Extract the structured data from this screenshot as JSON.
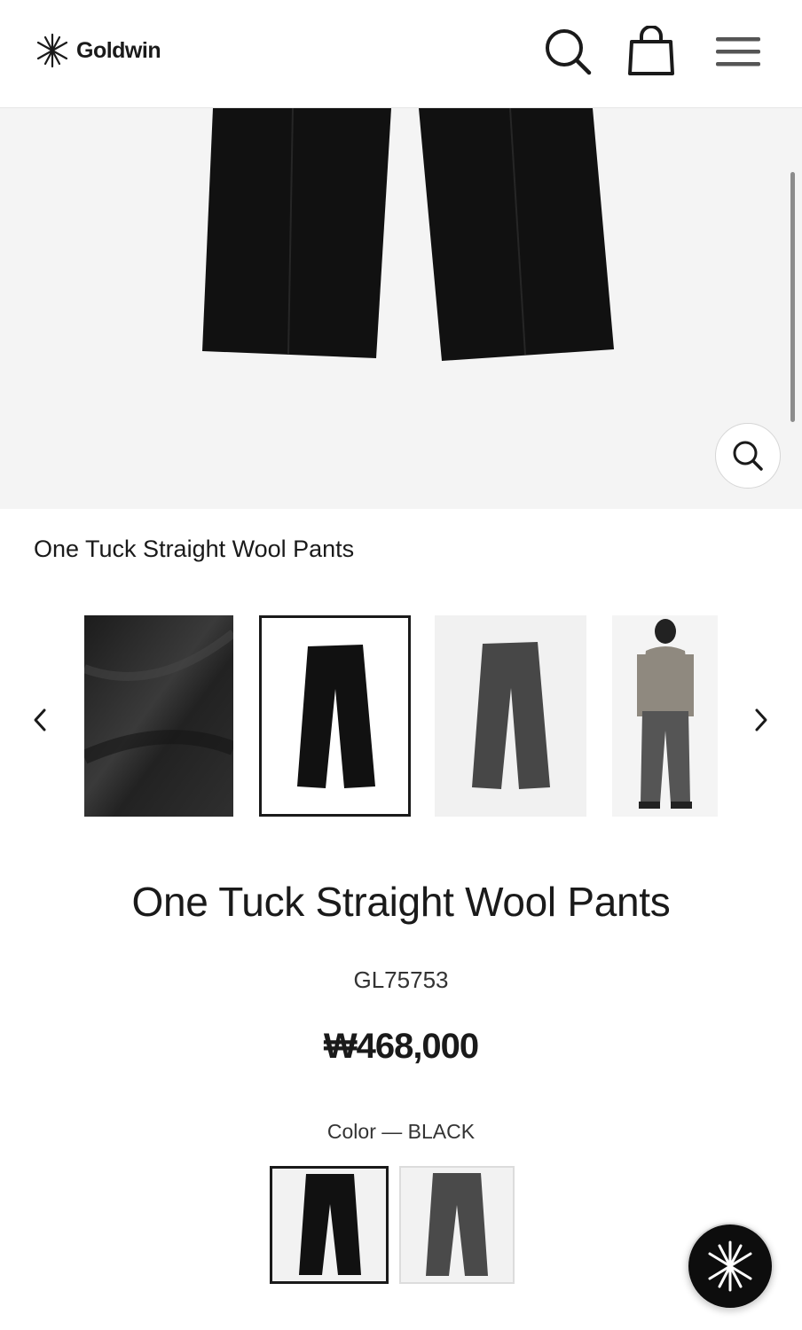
{
  "header": {
    "brand": "Goldwin",
    "icons": [
      "logo-icon",
      "search-icon",
      "cart-icon",
      "menu-icon"
    ]
  },
  "hero": {
    "zoom_icon": "zoom-icon"
  },
  "breadcrumb": {
    "title": "One Tuck Straight Wool Pants"
  },
  "gallery": {
    "thumbnails": [
      "fabric-closeup",
      "black-pants",
      "gray-pants",
      "model-look"
    ],
    "selected_index": 1
  },
  "product": {
    "name": "One Tuck Straight Wool Pants",
    "code": "GL75753",
    "price": "₩468,000",
    "color_label": "Color — BLACK",
    "colors": [
      "BLACK",
      "GRAY"
    ],
    "selected_color": "BLACK"
  },
  "colors": {
    "text": "#1a1a1a",
    "hero_bg": "#f4f4f4",
    "pants_black": "#111111",
    "pants_gray": "#4a4a4a"
  }
}
